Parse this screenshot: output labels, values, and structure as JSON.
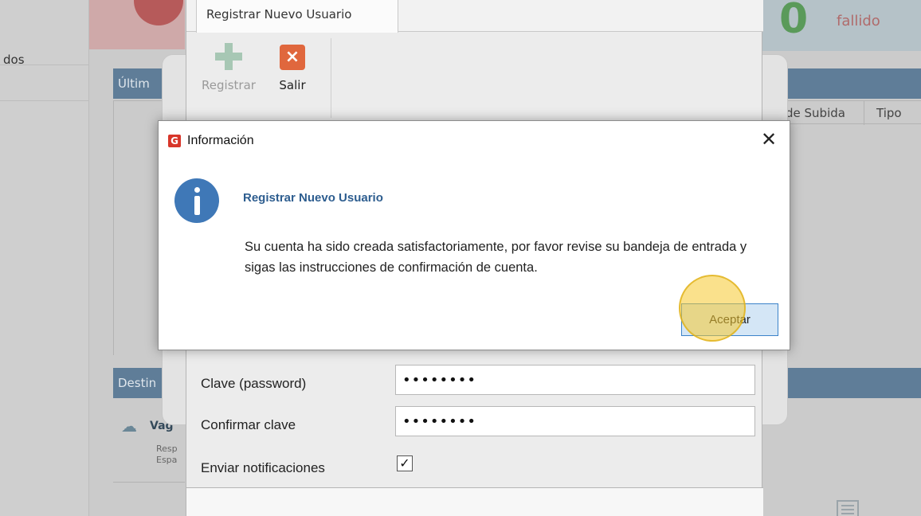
{
  "background": {
    "nav_item_partial": "dos",
    "stat_count": "0",
    "stat_label_partial": "fallido",
    "panel_last_partial": "Últim",
    "panel_dest_partial": "Destin",
    "columns": [
      "de Subida",
      "Tipo"
    ],
    "destination_name_partial": "Vag",
    "destination_line1_partial": "Resp",
    "destination_line2_partial": "Espa"
  },
  "register_window": {
    "tab_label": "Registrar Nuevo Usuario",
    "toolbar": {
      "register_label": "Registrar",
      "exit_label": "Salir"
    },
    "fields": {
      "password_label": "Clave (password)",
      "password_value": "••••••••",
      "confirm_label": "Confirmar clave",
      "confirm_value": "••••••••",
      "notify_label": "Enviar notificaciones",
      "notify_checked": true,
      "notify_mark": "✓"
    }
  },
  "dialog": {
    "title": "Información",
    "close_glyph": "✕",
    "heading": "Registrar Nuevo Usuario",
    "message": "Su cuenta ha sido creada satisfactoriamente, por favor revise su bandeja de entrada y sigas las instrucciones de confirmación de cuenta.",
    "accept_label": "Aceptar",
    "app_icon_letter": "G",
    "icon": "info-icon"
  },
  "colors": {
    "dialog_heading": "#2d5d8f",
    "accept_border": "#3b83c9",
    "accept_fill": "#d4e6f6",
    "info_icon": "#3f78b7",
    "exit_icon": "#e0673d",
    "register_icon": "#a7c7b4",
    "click_highlight": "#f6c82d"
  }
}
